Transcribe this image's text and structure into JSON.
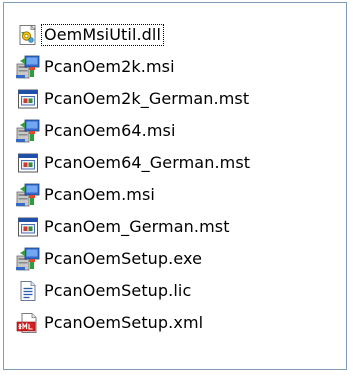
{
  "files": [
    {
      "name": "OemMsiUtil.dll",
      "icon": "dll-icon",
      "focused": true
    },
    {
      "name": "PcanOem2k.msi",
      "icon": "msi-icon",
      "focused": false
    },
    {
      "name": "PcanOem2k_German.mst",
      "icon": "mst-icon",
      "focused": false
    },
    {
      "name": "PcanOem64.msi",
      "icon": "msi-icon",
      "focused": false
    },
    {
      "name": "PcanOem64_German.mst",
      "icon": "mst-icon",
      "focused": false
    },
    {
      "name": "PcanOem.msi",
      "icon": "msi-icon",
      "focused": false
    },
    {
      "name": "PcanOem_German.mst",
      "icon": "mst-icon",
      "focused": false
    },
    {
      "name": "PcanOemSetup.exe",
      "icon": "installer-exe-icon",
      "focused": false
    },
    {
      "name": "PcanOemSetup.lic",
      "icon": "text-file-icon",
      "focused": false
    },
    {
      "name": "PcanOemSetup.xml",
      "icon": "xml-icon",
      "focused": false
    }
  ],
  "colors": {
    "border": "#7f9db9",
    "xml_red": "#d42020",
    "mst_blue": "#1f4fa8"
  }
}
